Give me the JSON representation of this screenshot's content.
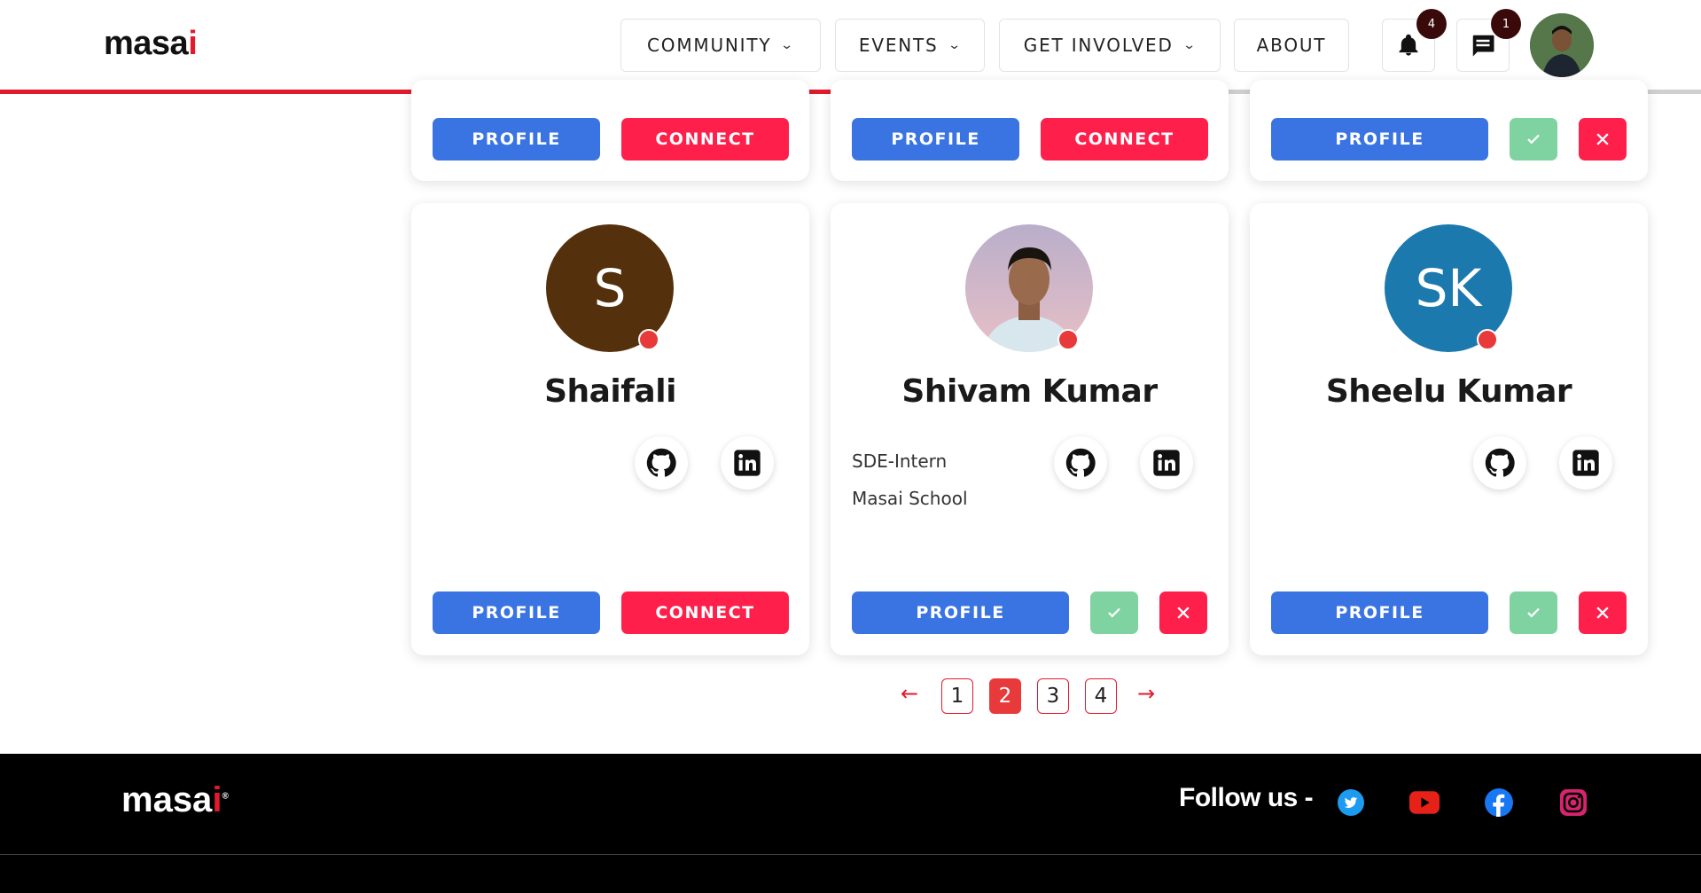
{
  "brand": {
    "logo": "masai"
  },
  "nav": {
    "community": "COMMUNITY",
    "events": "EVENTS",
    "get_involved": "GET INVOLVED",
    "about": "ABOUT",
    "notifications_count": "4",
    "messages_count": "1",
    "scroll_progress": 0.583
  },
  "buttons": {
    "profile": "PROFILE",
    "connect": "CONNECT"
  },
  "cards_top": [
    {
      "actions": "connect"
    },
    {
      "actions": "connect"
    },
    {
      "actions": "accept-reject"
    }
  ],
  "cards": [
    {
      "initials": "S",
      "name": "Shaifali",
      "avatar_color": "#55300c",
      "title": "",
      "company": "",
      "actions": "connect"
    },
    {
      "initials": "",
      "name": "Shivam Kumar",
      "avatar_color": "#c9b5c8",
      "title": "SDE-Intern",
      "company": "Masai School",
      "actions": "accept-reject"
    },
    {
      "initials": "SK",
      "name": "Sheelu Kumar",
      "avatar_color": "#1b79ad",
      "title": "",
      "company": "",
      "actions": "accept-reject"
    }
  ],
  "pagination": {
    "pages": [
      "1",
      "2",
      "3",
      "4"
    ],
    "current": "2",
    "prev": "←",
    "next": "→"
  },
  "footer": {
    "logo": "masai",
    "follow_label": "Follow us -"
  },
  "colors": {
    "accent": "#e11b2c",
    "profile_btn": "#3a74e2",
    "connect_btn": "#ff1f4b",
    "accept_btn": "#7fd3a1",
    "online_dot": "#e83a3a"
  }
}
